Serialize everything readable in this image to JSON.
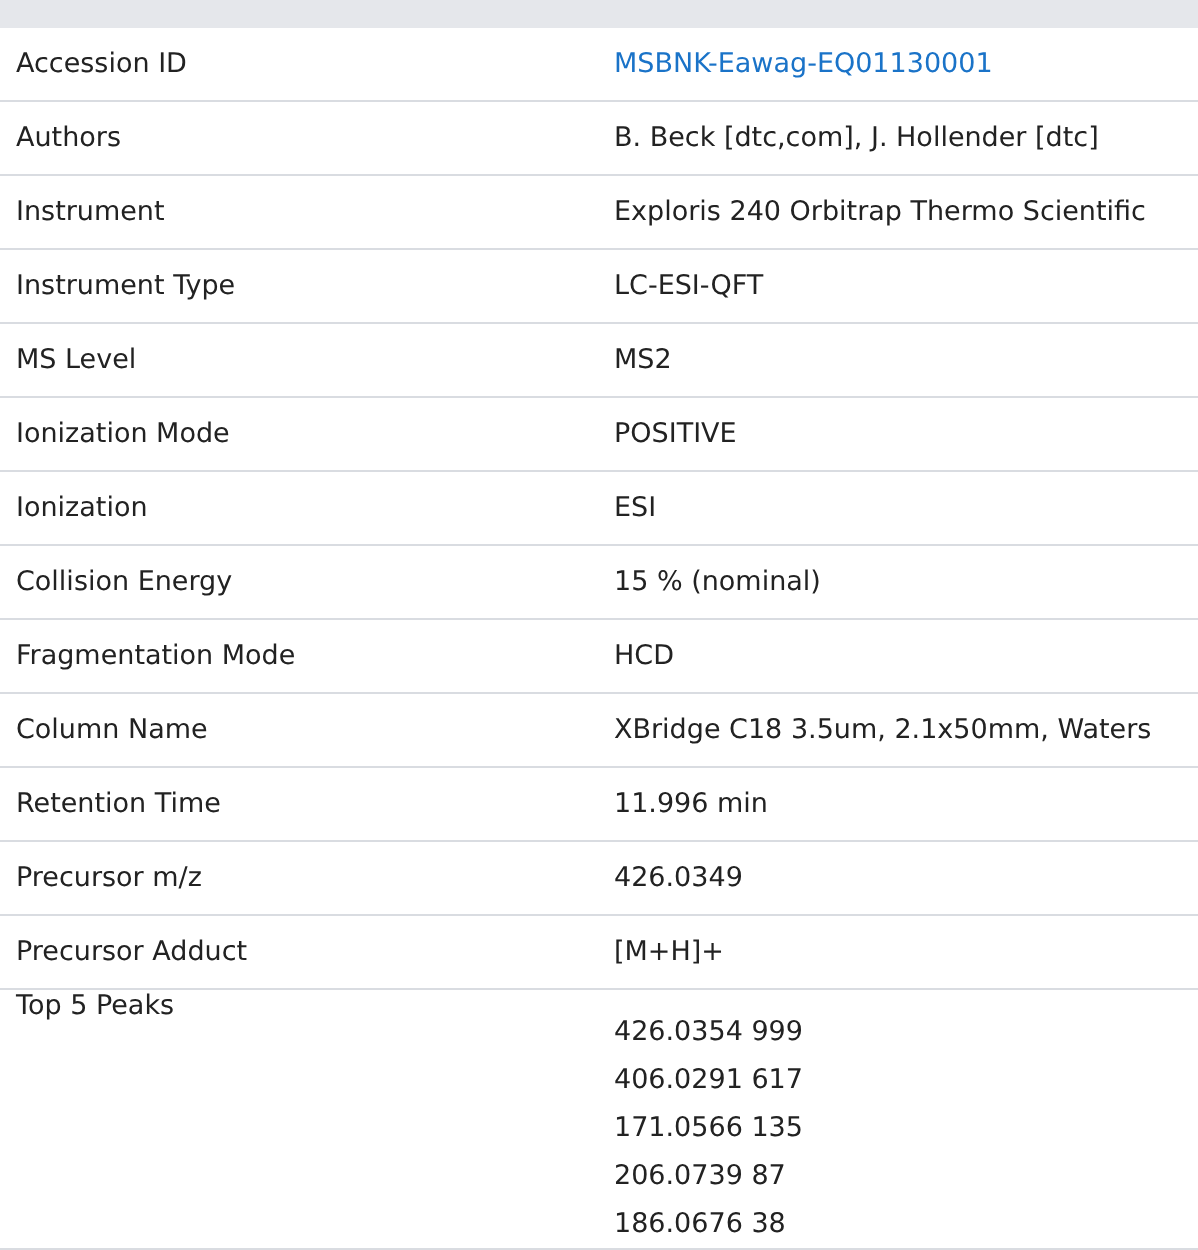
{
  "rows": [
    {
      "label": "Accession ID",
      "kind": "link",
      "value": "MSBNK-Eawag-EQ01130001"
    },
    {
      "label": "Authors",
      "kind": "text",
      "value": "B. Beck [dtc,com], J. Hollender [dtc]"
    },
    {
      "label": "Instrument",
      "kind": "text",
      "value": "Exploris 240 Orbitrap Thermo Scientific"
    },
    {
      "label": "Instrument Type",
      "kind": "text",
      "value": "LC-ESI-QFT"
    },
    {
      "label": "MS Level",
      "kind": "text",
      "value": "MS2"
    },
    {
      "label": "Ionization Mode",
      "kind": "text",
      "value": "POSITIVE"
    },
    {
      "label": "Ionization",
      "kind": "text",
      "value": "ESI"
    },
    {
      "label": "Collision Energy",
      "kind": "text",
      "value": "15 % (nominal)"
    },
    {
      "label": "Fragmentation Mode",
      "kind": "text",
      "value": "HCD"
    },
    {
      "label": "Column Name",
      "kind": "text",
      "value": "XBridge C18 3.5um, 2.1x50mm, Waters"
    },
    {
      "label": "Retention Time",
      "kind": "text",
      "value": "11.996 min"
    },
    {
      "label": "Precursor m/z",
      "kind": "text",
      "value": "426.0349"
    },
    {
      "label": "Precursor Adduct",
      "kind": "text",
      "value": "[M+H]+"
    },
    {
      "label": "Top 5 Peaks",
      "kind": "list",
      "values": [
        "426.0354 999",
        "406.0291 617",
        "171.0566 135",
        "206.0739 87",
        "186.0676 38"
      ]
    }
  ]
}
